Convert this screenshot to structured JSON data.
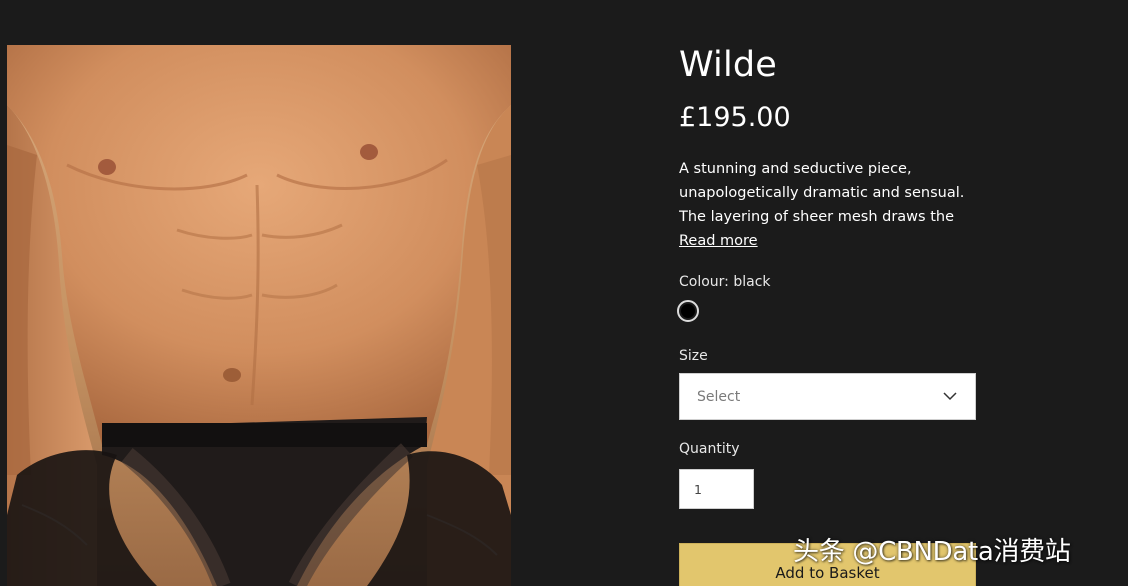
{
  "product": {
    "title": "Wilde",
    "price": "£195.00",
    "description": "A stunning and seductive piece, unapologetically dramatic and sensual. The layering of sheer mesh draws the",
    "read_more": "Read more",
    "image_icon": "product-photo"
  },
  "colour": {
    "label": "Colour: black",
    "swatches": [
      {
        "name": "black",
        "color": "#000000",
        "selected": true
      }
    ]
  },
  "size": {
    "label": "Size",
    "selected": "Select",
    "icon": "chevron-down-icon"
  },
  "quantity": {
    "label": "Quantity",
    "value": "1"
  },
  "add_to_basket": {
    "label": "Add to Basket"
  },
  "watermark": {
    "text": "头条 @CBNData消费站"
  },
  "colors": {
    "background": "#1b1b1b",
    "accent": "#e2c66d",
    "text": "#ffffff"
  }
}
